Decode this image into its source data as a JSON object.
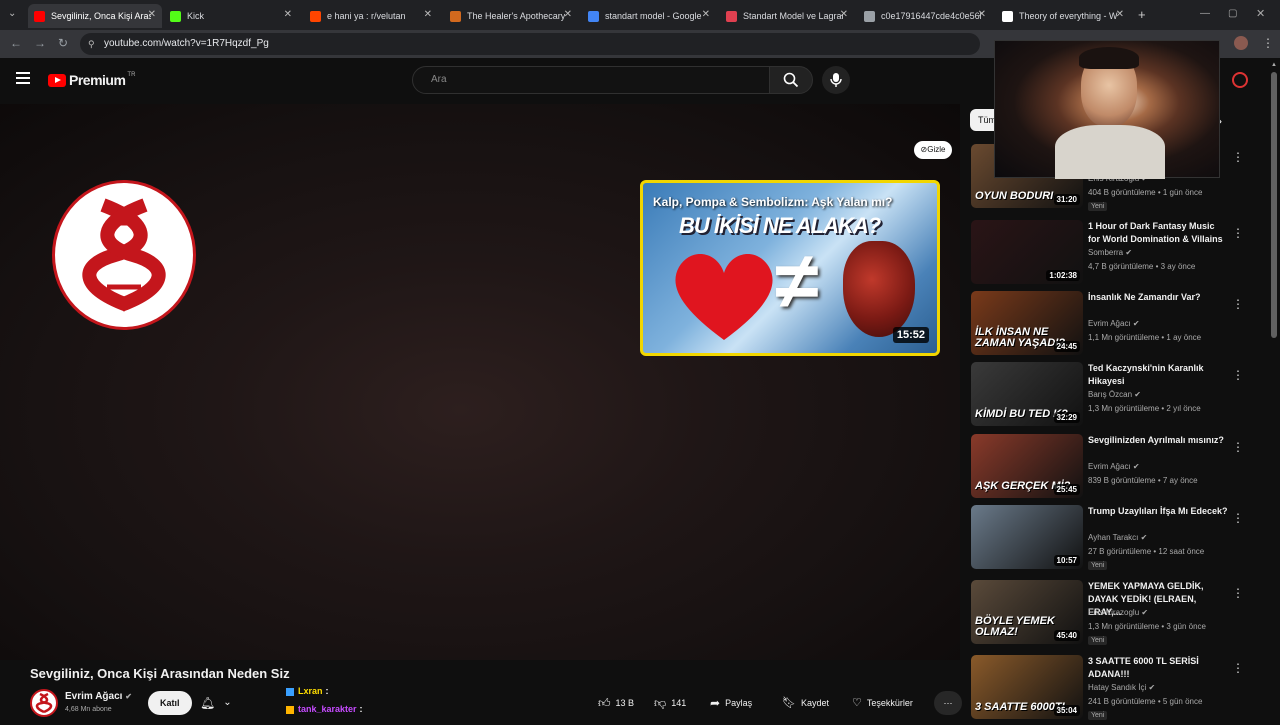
{
  "browser": {
    "tabs": [
      {
        "title": "Sevgiliniz, Onca Kişi Arasın",
        "favicon": "youtube-icon",
        "color": "#ff0000",
        "active": true
      },
      {
        "title": "Kick",
        "favicon": "kick-icon",
        "color": "#53fc18",
        "active": false
      },
      {
        "title": "e hani ya : r/velutan",
        "favicon": "reddit-icon",
        "color": "#ff4500",
        "active": false
      },
      {
        "title": "The Healer's Apothecary",
        "favicon": "apothecary-icon",
        "color": "#d2691e",
        "active": false
      },
      {
        "title": "standart model - Google",
        "favicon": "google-icon",
        "color": "#4285f4",
        "active": false
      },
      {
        "title": "Standart Model ve Lagran",
        "favicon": "site-icon",
        "color": "#e04050",
        "active": false
      },
      {
        "title": "c0e17916447cde4c0e56b",
        "favicon": "globe-icon",
        "color": "#9aa0a6",
        "active": false
      },
      {
        "title": "Theory of everything - W",
        "favicon": "wikipedia-icon",
        "color": "#ffffff",
        "active": false
      }
    ],
    "url": "youtube.com/watch?v=1R7Hqzdf_Pg"
  },
  "header": {
    "logo_text": "Premium",
    "logo_region": "TR",
    "search_placeholder": "Ara"
  },
  "player": {
    "endcard_title": "Kalp, Pompa & Sembolizm: Aşk Yalan mı?",
    "endcard_thumb_text": "BU İKİSİ NE ALAKA?",
    "endcard_duration": "15:52",
    "hide_label": "Gizle",
    "chip_partial": "Tüm"
  },
  "video": {
    "title": "Sevgiliniz, Onca Kişi Arasından Neden Siz",
    "channel": "Evrim Ağacı",
    "subscribers": "4,68 Mn abone",
    "join_label": "Katıl",
    "likes": "13 B",
    "dislikes": "141",
    "share_label": "Paylaş",
    "save_label": "Kaydet",
    "thanks_label": "Teşekkürler"
  },
  "chat": [
    {
      "user": "Lxran",
      "text": ":",
      "color": "#ffdd00"
    },
    {
      "user": "tank_karakter",
      "text": ":",
      "color": "#c64bff"
    }
  ],
  "sidebar": {
    "videos": [
      {
        "title": "",
        "channel": "Enis Kirazoglu",
        "meta": "404 B görüntüleme • 1 gün önce",
        "duration": "31:20",
        "badge": "Yeni",
        "thumb_text": "OYUN BODURI",
        "thumb_color": "#6a4a30"
      },
      {
        "title": "1 Hour of Dark Fantasy Music for World Domination & Villains",
        "channel": "Somberra",
        "meta": "4,7 B görüntüleme • 3 ay önce",
        "duration": "1:02:38",
        "badge": "",
        "thumb_text": "",
        "thumb_color": "#2a1416"
      },
      {
        "title": "İnsanlık Ne Zamandır Var?",
        "channel": "Evrim Ağacı",
        "meta": "1,1 Mn görüntüleme • 1 ay önce",
        "duration": "24:45",
        "badge": "",
        "thumb_text": "İLK İNSAN NE ZAMAN YAŞADI?",
        "thumb_color": "#7a3a1a"
      },
      {
        "title": "Ted Kaczynski'nin Karanlık Hikayesi",
        "channel": "Barış Özcan",
        "meta": "1,3 Mn görüntüleme • 2 yıl önce",
        "duration": "32:29",
        "badge": "",
        "thumb_text": "KİMDİ BU TED K?",
        "thumb_color": "#3a3a3a"
      },
      {
        "title": "Sevgilinizden Ayrılmalı mısınız?",
        "channel": "Evrim Ağacı",
        "meta": "839 B görüntüleme • 7 ay önce",
        "duration": "25:45",
        "badge": "",
        "thumb_text": "AŞK GERÇEK Mİ?",
        "thumb_color": "#8a3a2a"
      },
      {
        "title": "Trump Uzaylıları İfşa Mı Edecek?",
        "channel": "Ayhan Tarakcı",
        "meta": "27 B görüntüleme • 12 saat önce",
        "duration": "10:57",
        "badge": "Yeni",
        "thumb_text": "",
        "thumb_color": "#6a7a8a"
      },
      {
        "title": "YEMEK YAPMAYA GELDİK, DAYAK YEDİK! (ELRAEN, ERAY,...",
        "channel": "Enis Kirazoglu",
        "meta": "1,3 Mn görüntüleme • 3 gün önce",
        "duration": "45:40",
        "badge": "Yeni",
        "thumb_text": "BÖYLE YEMEK OLMAZ!",
        "thumb_color": "#5a4a3a"
      },
      {
        "title": "3 SAATTE 6000 TL SERİSİ ADANA!!!",
        "channel": "Hatay Sandık İçi",
        "meta": "241 B görüntüleme • 5 gün önce",
        "duration": "35:04",
        "badge": "Yeni",
        "thumb_text": "3 SAATTE 6000TL",
        "thumb_color": "#8a5a2a"
      }
    ]
  },
  "colors": {
    "accent": "#ff0000",
    "brand_red": "#c4161c",
    "endcard_border": "#f2d600",
    "background": "#0f0f0f"
  }
}
